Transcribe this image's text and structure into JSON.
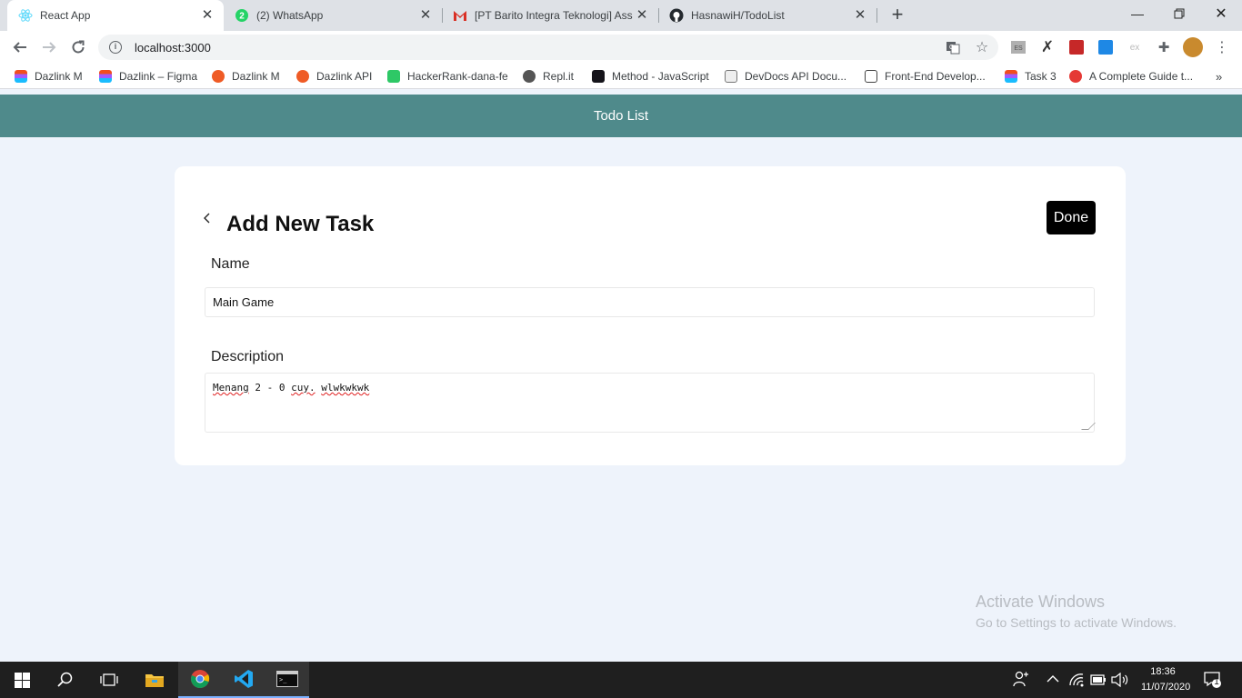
{
  "browser": {
    "tabs": [
      {
        "title": "React App",
        "icon": "react-icon"
      },
      {
        "title": "(2) WhatsApp",
        "icon": "whatsapp-icon"
      },
      {
        "title": "[PT Barito Integra Teknologi] Ass",
        "icon": "gmail-icon"
      },
      {
        "title": "HasnawiH/TodoList",
        "icon": "github-icon"
      }
    ],
    "url": "localhost:3000",
    "bookmarks": [
      "Dazlink M",
      "Dazlink – Figma",
      "Dazlink M",
      "Dazlink API",
      "HackerRank-dana-fe",
      "Repl.it",
      "Method - JavaScript",
      "DevDocs API Docu...",
      "Front-End Develop...",
      "Task 3",
      "A Complete Guide t..."
    ],
    "colors": {
      "tabstrip": "#dee1e6",
      "header": "#4f8a8b"
    }
  },
  "app": {
    "header_title": "Todo List",
    "page_title": "Add New Task",
    "done_label": "Done",
    "name_label": "Name",
    "name_value": "Main Game",
    "description_label": "Description",
    "description_words": [
      "Menang",
      "2",
      "-",
      "0",
      "cuy.",
      "wlwkwkwk"
    ]
  },
  "watermark": {
    "line1": "Activate Windows",
    "line2": "Go to Settings to activate Windows."
  },
  "taskbar": {
    "time": "18:36",
    "date": "11/07/2020",
    "notifications": "1"
  }
}
